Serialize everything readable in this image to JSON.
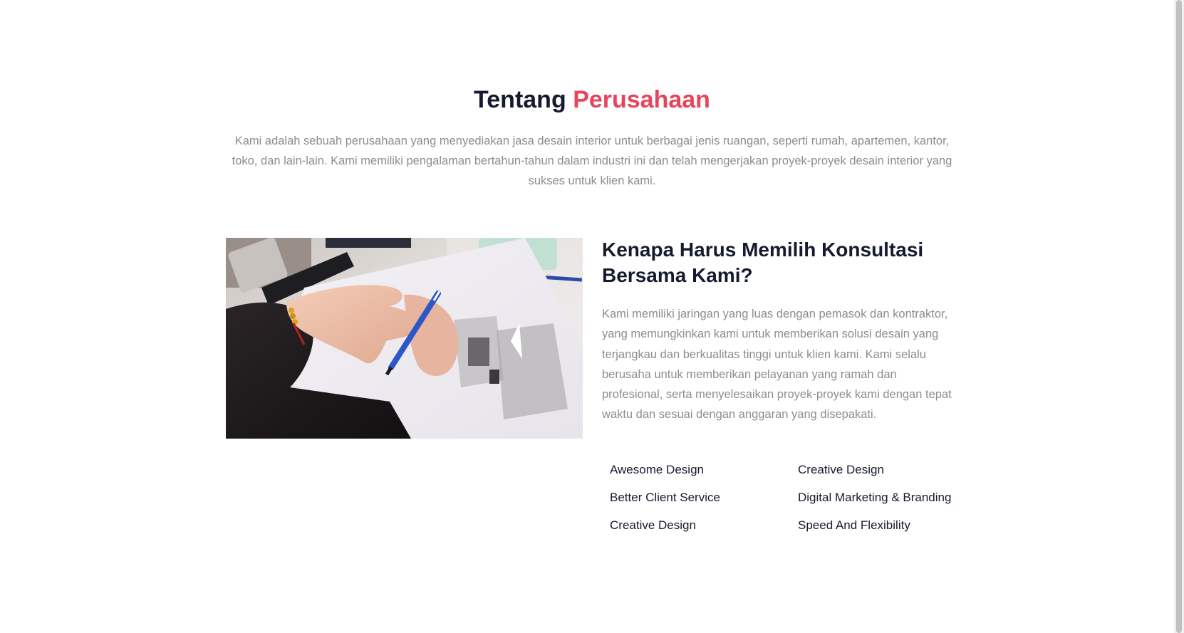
{
  "about": {
    "title_prefix": "Tentang",
    "title_accent": "Perusahaan",
    "intro": "Kami adalah sebuah perusahaan yang menyediakan jasa desain interior untuk berbagai jenis ruangan, seperti rumah, apartemen, kantor, toko, dan lain-lain. Kami memiliki pengalaman bertahun-tahun dalam industri ini dan telah mengerjakan proyek-proyek desain interior yang sukses untuk klien kami."
  },
  "why": {
    "title": "Kenapa Harus Memilih Konsultasi Bersama Kami?",
    "text": "Kami memiliki jaringan yang luas dengan pemasok dan kontraktor, yang memungkinkan kami untuk memberikan solusi desain yang terjangkau dan berkualitas tinggi untuk klien kami. Kami selalu berusaha untuk memberikan pelayanan yang ramah dan profesional, serta menyelesaikan proyek-proyek kami dengan tepat waktu dan sesuai dengan anggaran yang disepakati.",
    "features": [
      "Awesome Design",
      "Creative Design",
      "Better Client Service",
      "Digital Marketing & Branding",
      "Creative Design",
      "Speed And Flexibility"
    ]
  },
  "colors": {
    "accent": "#e6455c",
    "heading": "#161a2f",
    "muted_text": "#8c8c94"
  },
  "image": {
    "subject": "photo-hands-drawing-architectural-sketch"
  }
}
